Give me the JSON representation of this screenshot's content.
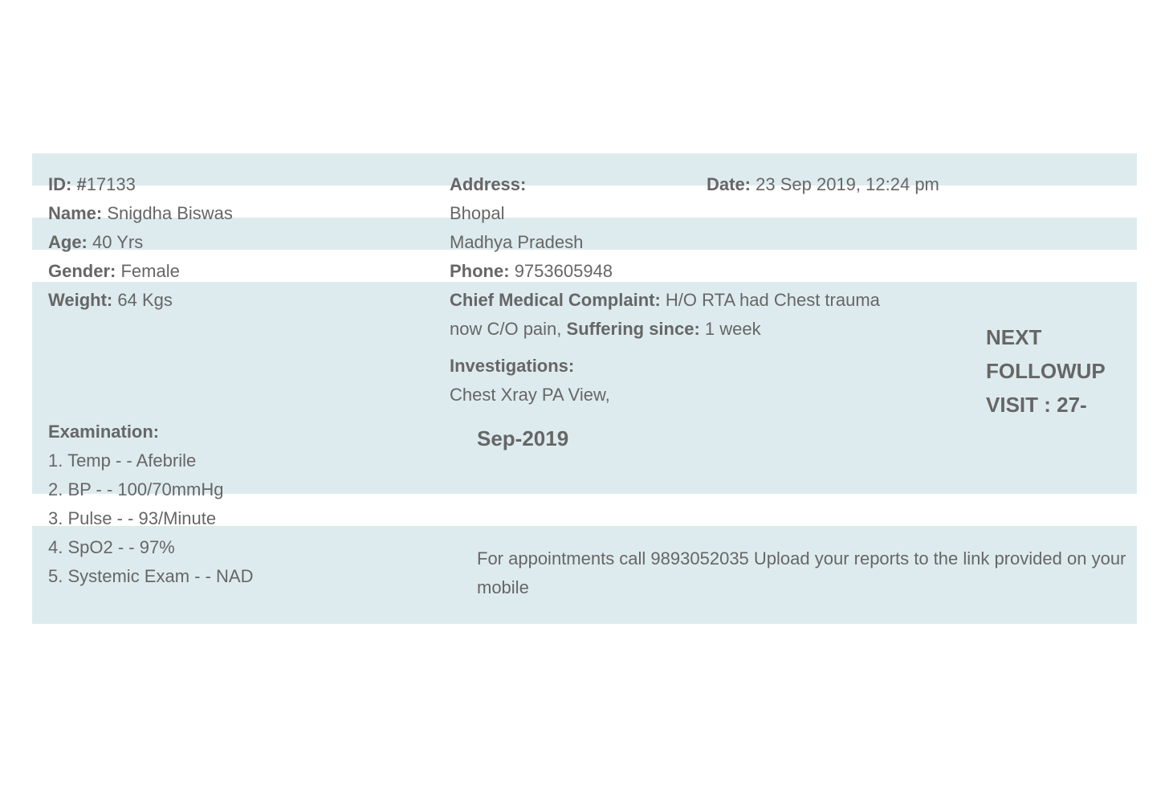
{
  "patient": {
    "id_label": "ID: #",
    "id_value": "17133",
    "name_label": "Name:",
    "name_value": "Snigdha Biswas",
    "age_label": "Age:",
    "age_value": "40 Yrs",
    "gender_label": "Gender:",
    "gender_value": "Female",
    "weight_label": "Weight:",
    "weight_value": "64 Kgs"
  },
  "address": {
    "label": "Address:",
    "line1": "Bhopal",
    "line2": "Madhya Pradesh",
    "phone_label": "Phone:",
    "phone_value": "9753605948"
  },
  "visit": {
    "date_label": "Date:",
    "date_value": "23 Sep 2019, 12:24 pm"
  },
  "complaint": {
    "label": "Chief Medical Complaint:",
    "value_line1": "H/O RTA had Chest trauma",
    "value_line2": "now C/O pain,",
    "since_label": "Suffering since:",
    "since_value": "1 week"
  },
  "investigations": {
    "label": "Investigations:",
    "value": "Chest Xray PA View,"
  },
  "followup": {
    "line1": "NEXT",
    "line2": "FOLLOWUP",
    "line3": "VISIT : 27-",
    "line4": "Sep-2019"
  },
  "examination": {
    "label": "Examination:",
    "items": [
      "1. Temp - - Afebrile",
      "2. BP - - 100/70mmHg",
      "3. Pulse - - 93/Minute",
      "4. SpO2 - - 97%",
      "5. Systemic Exam - - NAD"
    ]
  },
  "footer": {
    "note": "For appointments call 9893052035 Upload your reports to the link provided on your mobile"
  },
  "colors": {
    "band": "#deebee",
    "text": "#666666"
  }
}
